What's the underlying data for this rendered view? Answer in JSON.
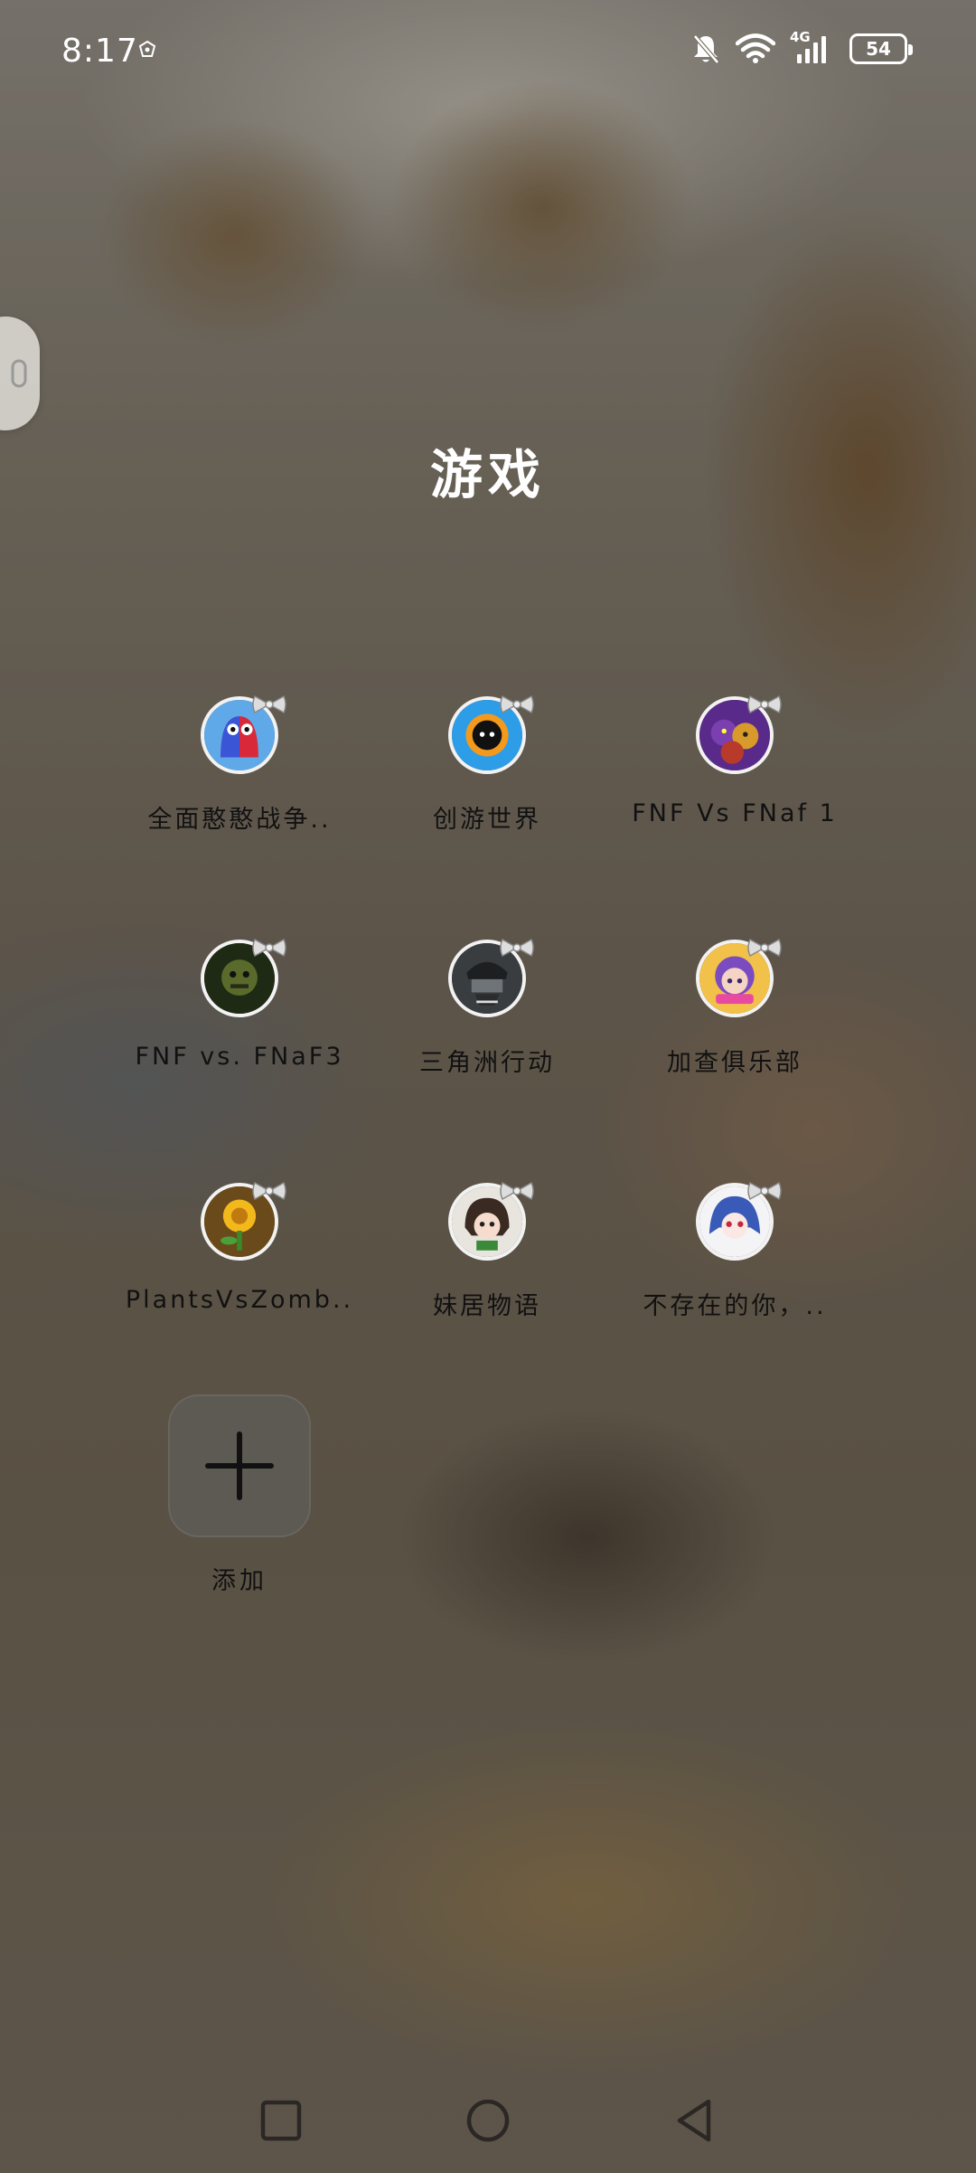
{
  "status_bar": {
    "time": "8:17",
    "network": "4G",
    "battery": "54"
  },
  "folder": {
    "title": "游戏"
  },
  "apps": [
    {
      "label": "全面憨憨战争..",
      "icon": "rainbow-friends-icon"
    },
    {
      "label": "创游世界",
      "icon": "creator-world-icon"
    },
    {
      "label": "FNF Vs FNaf 1",
      "icon": "fnf-fnaf1-icon"
    },
    {
      "label": "FNF vs. FNaF3",
      "icon": "fnf-fnaf3-icon"
    },
    {
      "label": "三角洲行动",
      "icon": "delta-force-icon"
    },
    {
      "label": "加查俱乐部",
      "icon": "gacha-club-icon"
    },
    {
      "label": "PlantsVsZomb..",
      "icon": "plants-vs-zombies-icon"
    },
    {
      "label": "妹居物语",
      "icon": "sister-story-icon"
    },
    {
      "label": "不存在的你，..",
      "icon": "nonexistent-you-icon"
    }
  ],
  "add": {
    "label": "添加"
  },
  "nav": {
    "recent": "recent-apps-icon",
    "home": "home-icon",
    "back": "back-icon"
  }
}
